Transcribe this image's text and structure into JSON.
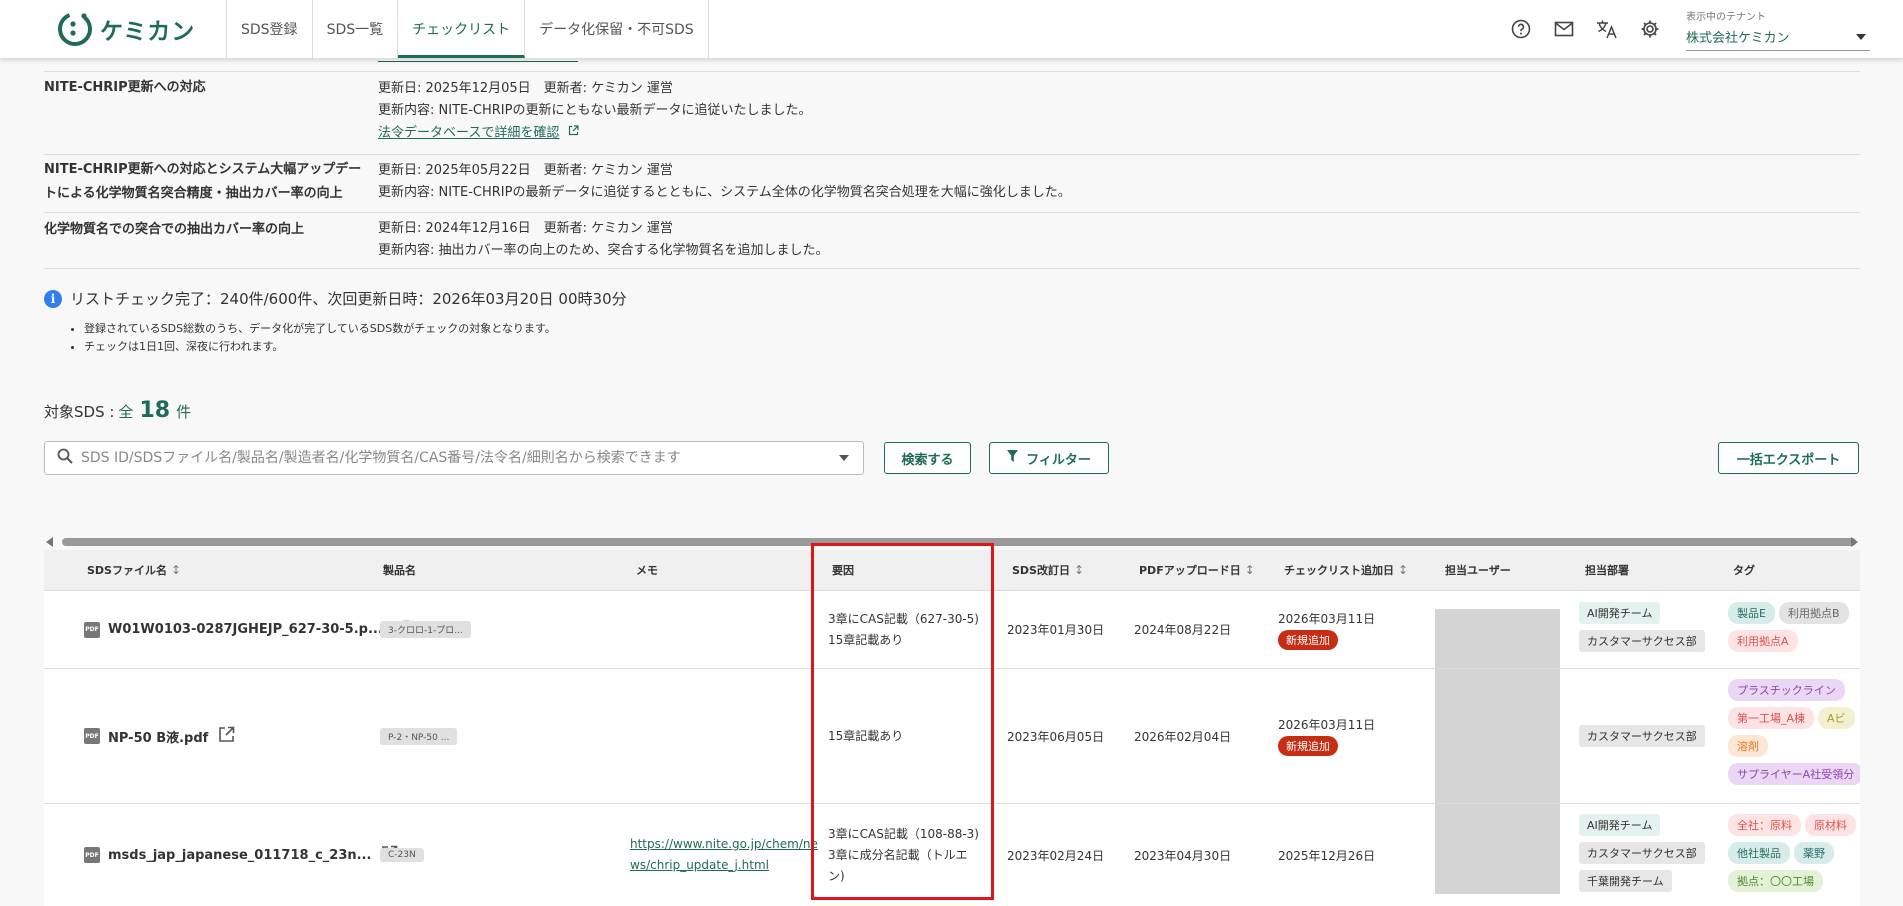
{
  "brand": {
    "name": "ケミカン",
    "color": "#1f6b57"
  },
  "nav": {
    "tabs": [
      {
        "label": "SDS登録"
      },
      {
        "label": "SDS一覧"
      },
      {
        "label": "チェックリスト"
      },
      {
        "label": "データ化保留・不可SDS"
      }
    ],
    "active": "チェックリスト"
  },
  "header_icons": [
    "help-icon",
    "mail-icon",
    "translate-icon",
    "settings-icon"
  ],
  "tenant": {
    "label": "表示中のテナント",
    "value": "株式会社ケミカン"
  },
  "updates": [
    {
      "title": "NITE-CHRIP更新への対応",
      "meta": "更新日: 2025年12月05日　更新者: ケミカン 運営",
      "content": "更新内容: NITE-CHRIPの更新にともない最新データに追従いたしました。",
      "link": "法令データベースで詳細を確認"
    },
    {
      "title": "NITE-CHRIP更新への対応とシステム大幅アップデートによる化学物質名突合精度・抽出カバー率の向上",
      "meta": "更新日: 2025年05月22日　更新者: ケミカン 運営",
      "content": "更新内容: NITE-CHRIPの最新データに追従するとともに、システム全体の化学物質名突合処理を大幅に強化しました。"
    },
    {
      "title": "化学物質名での突合での抽出カバー率の向上",
      "meta": "更新日: 2024年12月16日　更新者: ケミカン 運営",
      "content": "更新内容: 抽出カバー率の向上のため、突合する化学物質名を追加しました。"
    }
  ],
  "info": {
    "status": "リストチェック完了：240件/600件、次回更新日時：2026年03月20日 00時30分",
    "notes": [
      "登録されているSDS総数のうち、データ化が完了しているSDS数がチェックの対象となります。",
      "チェックは1日1回、深夜に行われます。"
    ]
  },
  "count": {
    "label": "対象SDS :",
    "all": "全",
    "value": "18",
    "unit": "件"
  },
  "search": {
    "placeholder": "SDS ID/SDSファイル名/製品名/製造者名/化学物質名/CAS番号/法令名/細則名から検索できます"
  },
  "buttons": {
    "search": "検索する",
    "filter": "フィルター",
    "export": "一括エクスポート"
  },
  "table": {
    "headers": {
      "file": "SDSファイル名",
      "product": "製品名",
      "memo": "メモ",
      "reason": "要因",
      "revised": "SDS改訂日",
      "uploaded": "PDFアップロード日",
      "added": "チェックリスト追加日",
      "user": "担当ユーザー",
      "dept": "担当部署",
      "tags": "タグ"
    },
    "rows": [
      {
        "file": "W01W0103-0287JGHEJP_627-30-5.p...",
        "product": "3-クロロ-1-プロ...",
        "memo": "",
        "reason": [
          "3章にCAS記載（627-30-5)",
          "15章記載あり"
        ],
        "revised": "2023年01月30日",
        "uploaded": "2024年08月22日",
        "added": "2026年03月11日",
        "badge": "新規追加",
        "depts": [
          "AI開発チーム",
          "カスタマーサクセス部"
        ],
        "tags": [
          "製品E",
          "利用拠点B",
          "利用拠点A"
        ]
      },
      {
        "file": "NP-50 B液.pdf",
        "product": "P-2・NP-50 ...",
        "memo": "",
        "reason": [
          "15章記載あり"
        ],
        "revised": "2023年06月05日",
        "uploaded": "2026年02月04日",
        "added": "2026年03月11日",
        "badge": "新規追加",
        "depts": [
          "カスタマーサクセス部"
        ],
        "tags": [
          "プラスチックライン",
          "第一工場_A棟",
          "Aビ",
          "溶剤",
          "サプライヤーA社受領分"
        ]
      },
      {
        "file": "msds_jap_japanese_011718_c_23n...",
        "product": "C-23N",
        "memo": [
          "https://www.nite.go.jp/chem/ne",
          "ws/chrip_update_j.html"
        ],
        "reason": [
          "3章にCAS記載（108-88-3)",
          "3章に成分名記載（トルエ",
          "ン)"
        ],
        "revised": "2023年02月24日",
        "uploaded": "2023年04月30日",
        "added": "2025年12月26日",
        "badge": "",
        "depts": [
          "AI開発チーム",
          "カスタマーサクセス部",
          "千葉開発チーム"
        ],
        "tags": [
          "全社：原料",
          "原材料",
          "他社製品",
          "薬野",
          "拠点：〇〇工場"
        ]
      }
    ]
  },
  "colors": {
    "accent": "#1f6b57",
    "highlight_box": "#e0151c",
    "new_badge": "#c62d12",
    "info_icon": "#2f80ed"
  }
}
